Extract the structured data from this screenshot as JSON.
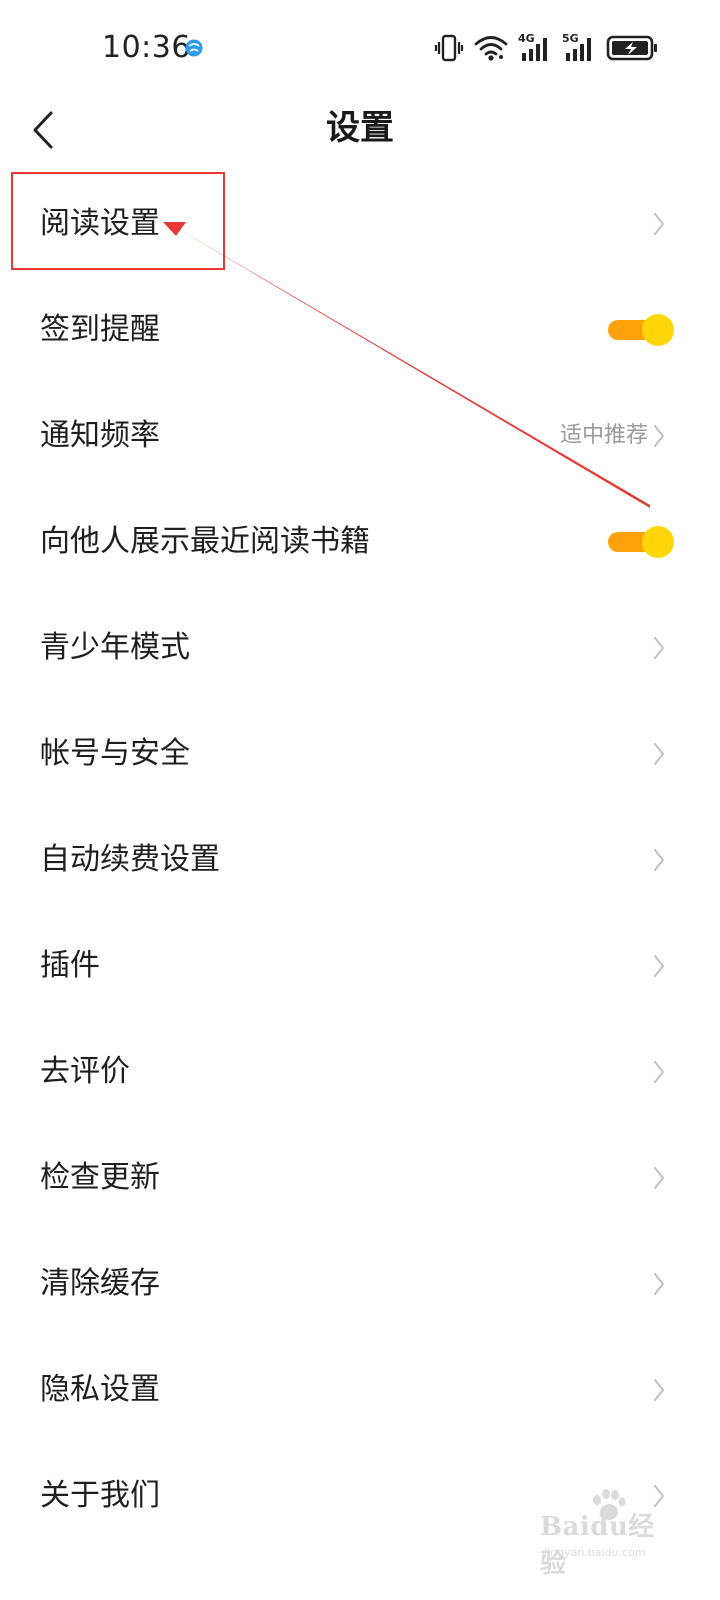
{
  "status_bar": {
    "time": "10:36",
    "network_4g": "4G",
    "network_5g": "5G"
  },
  "header": {
    "title": "设置",
    "back_icon": "chevron-left-icon"
  },
  "settings": [
    {
      "id": "reading-settings",
      "label": "阅读设置",
      "control": "chevron"
    },
    {
      "id": "check-in-reminder",
      "label": "签到提醒",
      "control": "toggle",
      "on": true
    },
    {
      "id": "notification-frequency",
      "label": "通知频率",
      "control": "chevron",
      "value": "适中推荐"
    },
    {
      "id": "show-recent-books",
      "label": "向他人展示最近阅读书籍",
      "control": "toggle",
      "on": true
    },
    {
      "id": "teen-mode",
      "label": "青少年模式",
      "control": "chevron"
    },
    {
      "id": "account-security",
      "label": "帐号与安全",
      "control": "chevron"
    },
    {
      "id": "auto-renewal",
      "label": "自动续费设置",
      "control": "chevron"
    },
    {
      "id": "plugins",
      "label": "插件",
      "control": "chevron"
    },
    {
      "id": "rate-app",
      "label": "去评价",
      "control": "chevron"
    },
    {
      "id": "check-update",
      "label": "检查更新",
      "control": "chevron"
    },
    {
      "id": "clear-cache",
      "label": "清除缓存",
      "control": "chevron"
    },
    {
      "id": "privacy-settings",
      "label": "隐私设置",
      "control": "chevron"
    },
    {
      "id": "about-us",
      "label": "关于我们",
      "control": "chevron"
    }
  ],
  "colors": {
    "toggle_track": "#ffa10a",
    "toggle_thumb": "#ffd60a",
    "annotation": "#e53935",
    "chevron": "#c4c4c4",
    "secondary_text": "#9a9a9a"
  },
  "watermark": {
    "brand": "Baidu经验",
    "url": "jingyan.baidu.com"
  }
}
